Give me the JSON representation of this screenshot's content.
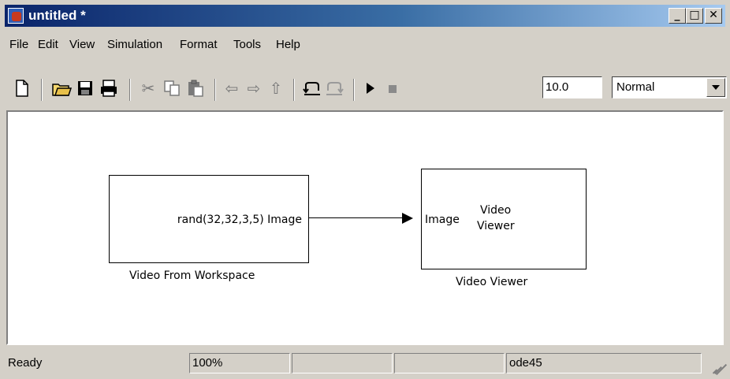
{
  "window": {
    "title": "untitled *",
    "controls": {
      "minimize": "_",
      "maximize": "□",
      "close": "✕"
    }
  },
  "menu": {
    "items": [
      "File",
      "Edit",
      "View",
      "Simulation",
      "Format",
      "Tools",
      "Help"
    ]
  },
  "toolbar": {
    "icons": [
      "new-icon",
      "open-icon",
      "save-icon",
      "print-icon",
      "cut-icon",
      "copy-icon",
      "paste-icon",
      "back-icon",
      "forward-icon",
      "up-icon",
      "undo-icon",
      "redo-icon",
      "start-icon",
      "stop-icon"
    ],
    "stop_time": "10.0",
    "sim_mode": "Normal"
  },
  "model": {
    "blocks": [
      {
        "name": "Video From Workspace",
        "content": "rand(32,32,3,5)",
        "output_port": "Image"
      },
      {
        "name": "Video Viewer",
        "content_line1": "Video",
        "content_line2": "Viewer",
        "input_port": "Image"
      }
    ]
  },
  "status": {
    "state": "Ready",
    "zoom": "100%",
    "pane3": "",
    "pane4": "",
    "solver": "ode45"
  }
}
